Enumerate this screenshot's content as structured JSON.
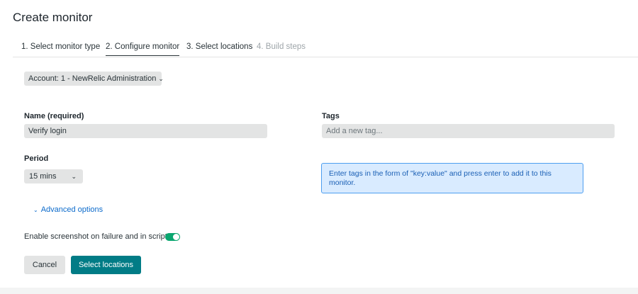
{
  "page": {
    "title": "Create monitor"
  },
  "tabs": [
    {
      "label": "1. Select monitor type",
      "state": "done"
    },
    {
      "label": "2. Configure monitor",
      "state": "active"
    },
    {
      "label": "3. Select locations",
      "state": "pending"
    },
    {
      "label": "4. Build steps",
      "state": "disabled"
    }
  ],
  "account": {
    "label": "Account: 1 - NewRelic Administration"
  },
  "name_field": {
    "label": "Name (required)",
    "value": "Verify login"
  },
  "tags_field": {
    "label": "Tags",
    "placeholder": "Add a new tag..."
  },
  "period": {
    "label": "Period",
    "value": "15 mins"
  },
  "tags_hint": {
    "text": "Enter tags in the form of \"key:value\" and press enter to add it to this monitor."
  },
  "advanced": {
    "label": "Advanced options"
  },
  "screenshot_toggle": {
    "label": "Enable screenshot on failure and in script",
    "enabled": true
  },
  "buttons": {
    "cancel": "Cancel",
    "primary": "Select locations"
  },
  "colors": {
    "accent": "#017c86",
    "toggle_on": "#0aa66f",
    "link": "#0b6acb",
    "info_bg": "#d9ebff",
    "info_border": "#4d9ef0"
  },
  "icons": {
    "chevron": "chevron-down-icon"
  }
}
